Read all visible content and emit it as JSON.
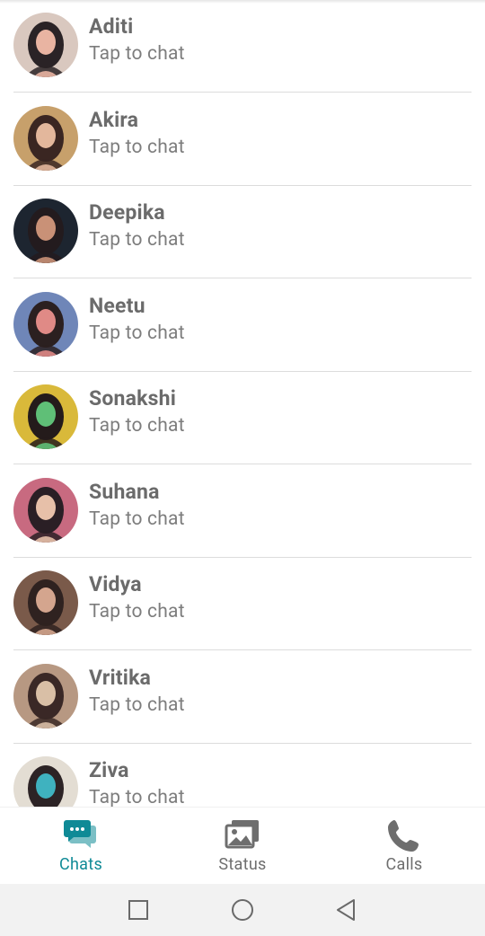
{
  "chats": [
    {
      "name": "Aditi",
      "subtitle": "Tap to chat",
      "avatar_colors": [
        "#d9c8bf",
        "#2a2326",
        "#e9b4a2"
      ]
    },
    {
      "name": "Akira",
      "subtitle": "Tap to chat",
      "avatar_colors": [
        "#c7a06b",
        "#3a2622",
        "#e3b79c"
      ]
    },
    {
      "name": "Deepika",
      "subtitle": "Tap to chat",
      "avatar_colors": [
        "#1d2530",
        "#231b1e",
        "#c99177"
      ]
    },
    {
      "name": "Neetu",
      "subtitle": "Tap to chat",
      "avatar_colors": [
        "#6f86b8",
        "#2b2020",
        "#e08a86"
      ]
    },
    {
      "name": "Sonakshi",
      "subtitle": "Tap to chat",
      "avatar_colors": [
        "#d9b93a",
        "#241b1b",
        "#5fbf77"
      ]
    },
    {
      "name": "Suhana",
      "subtitle": "Tap to chat",
      "avatar_colors": [
        "#c86a80",
        "#2a1f25",
        "#e7c0a9"
      ]
    },
    {
      "name": "Vidya",
      "subtitle": "Tap to chat",
      "avatar_colors": [
        "#7a5a4a",
        "#2f2220",
        "#d4a58e"
      ]
    },
    {
      "name": "Vritika",
      "subtitle": "Tap to chat",
      "avatar_colors": [
        "#b79882",
        "#3a2826",
        "#d9bfa6"
      ]
    },
    {
      "name": "Ziva",
      "subtitle": "Tap to chat",
      "avatar_colors": [
        "#e3ddd3",
        "#2c2325",
        "#3fb2bf"
      ]
    }
  ],
  "nav": {
    "chats_label": "Chats",
    "status_label": "Status",
    "calls_label": "Calls",
    "active": "chats",
    "active_color": "#0f8a96",
    "inactive_color": "#6e6e6e"
  },
  "system_nav": {
    "icons": [
      "square-recents-icon",
      "circle-home-icon",
      "triangle-back-icon"
    ]
  }
}
